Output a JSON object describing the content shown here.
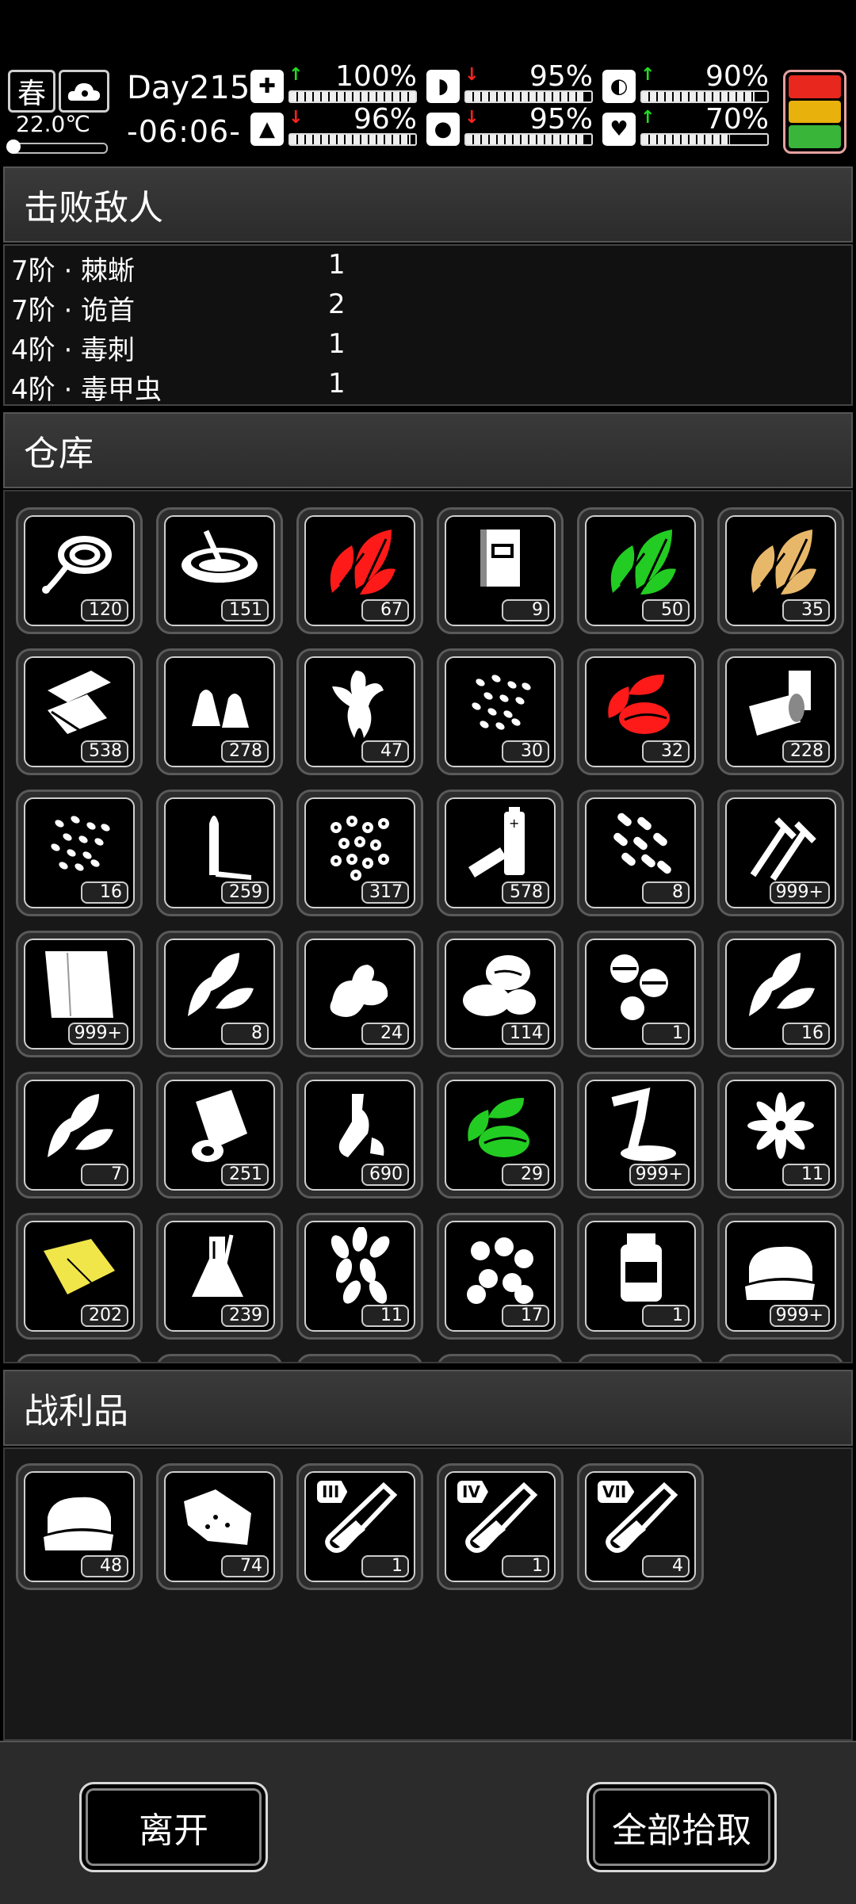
{
  "status": {
    "season": "春",
    "temperature": "22.0℃",
    "day": "Day215",
    "time": "-06:06-",
    "stats": [
      {
        "icon": "medkit-icon",
        "arrow": "up",
        "value": "100%",
        "level": 1.0
      },
      {
        "icon": "stomach-icon",
        "arrow": "down",
        "value": "95%",
        "level": 0.95
      },
      {
        "icon": "mood-icon",
        "arrow": "up",
        "value": "90%",
        "level": 0.9
      },
      {
        "icon": "stamina-icon",
        "arrow": "down",
        "value": "96%",
        "level": 0.96
      },
      {
        "icon": "water-drop-icon",
        "arrow": "down",
        "value": "95%",
        "level": 0.95
      },
      {
        "icon": "heart-icon",
        "arrow": "up",
        "value": "70%",
        "level": 0.7
      }
    ],
    "alert_colors": [
      "#e8281e",
      "#e8b10c",
      "#39b53a"
    ]
  },
  "defeated": {
    "title": "击败敌人",
    "rows": [
      {
        "name": "7阶 · 棘蜥",
        "count": "1"
      },
      {
        "name": "7阶 · 诡首",
        "count": "2"
      },
      {
        "name": "4阶 · 毒刺",
        "count": "1"
      },
      {
        "name": "4阶 · 毒甲虫",
        "count": "1"
      }
    ]
  },
  "storage": {
    "title": "仓库",
    "items": [
      {
        "icon": "rope-icon",
        "count": "120"
      },
      {
        "icon": "bowl-icon",
        "count": "151"
      },
      {
        "icon": "red-herb-icon",
        "count": "67",
        "color": "#ff1a1a"
      },
      {
        "icon": "book-icon",
        "count": "9"
      },
      {
        "icon": "green-herb-icon",
        "count": "50",
        "color": "#22cc22"
      },
      {
        "icon": "yellow-herb-icon",
        "count": "35",
        "color": "#e8b86a"
      },
      {
        "icon": "paper-icon",
        "count": "538"
      },
      {
        "icon": "bullets-icon",
        "count": "278"
      },
      {
        "icon": "ginseng-icon",
        "count": "47"
      },
      {
        "icon": "seeds-icon",
        "count": "30"
      },
      {
        "icon": "red-fruit-icon",
        "count": "32",
        "color": "#ff1a1a"
      },
      {
        "icon": "tube-icon",
        "count": "228"
      },
      {
        "icon": "small-seeds-icon",
        "count": "16"
      },
      {
        "icon": "rifle-bullet-icon",
        "count": "259"
      },
      {
        "icon": "pellets-icon",
        "count": "317"
      },
      {
        "icon": "battery-icon",
        "count": "578"
      },
      {
        "icon": "capsules-icon",
        "count": "8"
      },
      {
        "icon": "nails-icon",
        "count": "999+"
      },
      {
        "icon": "cloth-icon",
        "count": "999+"
      },
      {
        "icon": "mint-icon",
        "count": "8"
      },
      {
        "icon": "ginger-icon",
        "count": "24"
      },
      {
        "icon": "beans-icon",
        "count": "114"
      },
      {
        "icon": "pills-icon",
        "count": "1"
      },
      {
        "icon": "branch-icon",
        "count": "16"
      },
      {
        "icon": "leaf-icon",
        "count": "7"
      },
      {
        "icon": "bandage-roll-icon",
        "count": "251"
      },
      {
        "icon": "bottle-scrap-icon",
        "count": "690"
      },
      {
        "icon": "green-fruit-icon",
        "count": "29",
        "color": "#22cc22"
      },
      {
        "icon": "powder-icon",
        "count": "999+"
      },
      {
        "icon": "star-flower-icon",
        "count": "11"
      },
      {
        "icon": "yellow-cloth-icon",
        "count": "202",
        "color": "#f0e64a"
      },
      {
        "icon": "flask-icon",
        "count": "239"
      },
      {
        "icon": "petals-icon",
        "count": "11"
      },
      {
        "icon": "nuts-icon",
        "count": "17"
      },
      {
        "icon": "medicine-bottle-icon",
        "count": "1"
      },
      {
        "icon": "folded-fabric-icon",
        "count": "999+"
      }
    ]
  },
  "loot": {
    "title": "战利品",
    "items": [
      {
        "icon": "folded-fabric-icon",
        "count": "48"
      },
      {
        "icon": "hide-icon",
        "count": "74"
      },
      {
        "icon": "test-tube-icon",
        "count": "1",
        "tag": "III"
      },
      {
        "icon": "test-tube-icon",
        "count": "1",
        "tag": "IV"
      },
      {
        "icon": "test-tube-icon",
        "count": "4",
        "tag": "VII"
      }
    ]
  },
  "buttons": {
    "leave": "离开",
    "pick_all": "全部拾取"
  }
}
